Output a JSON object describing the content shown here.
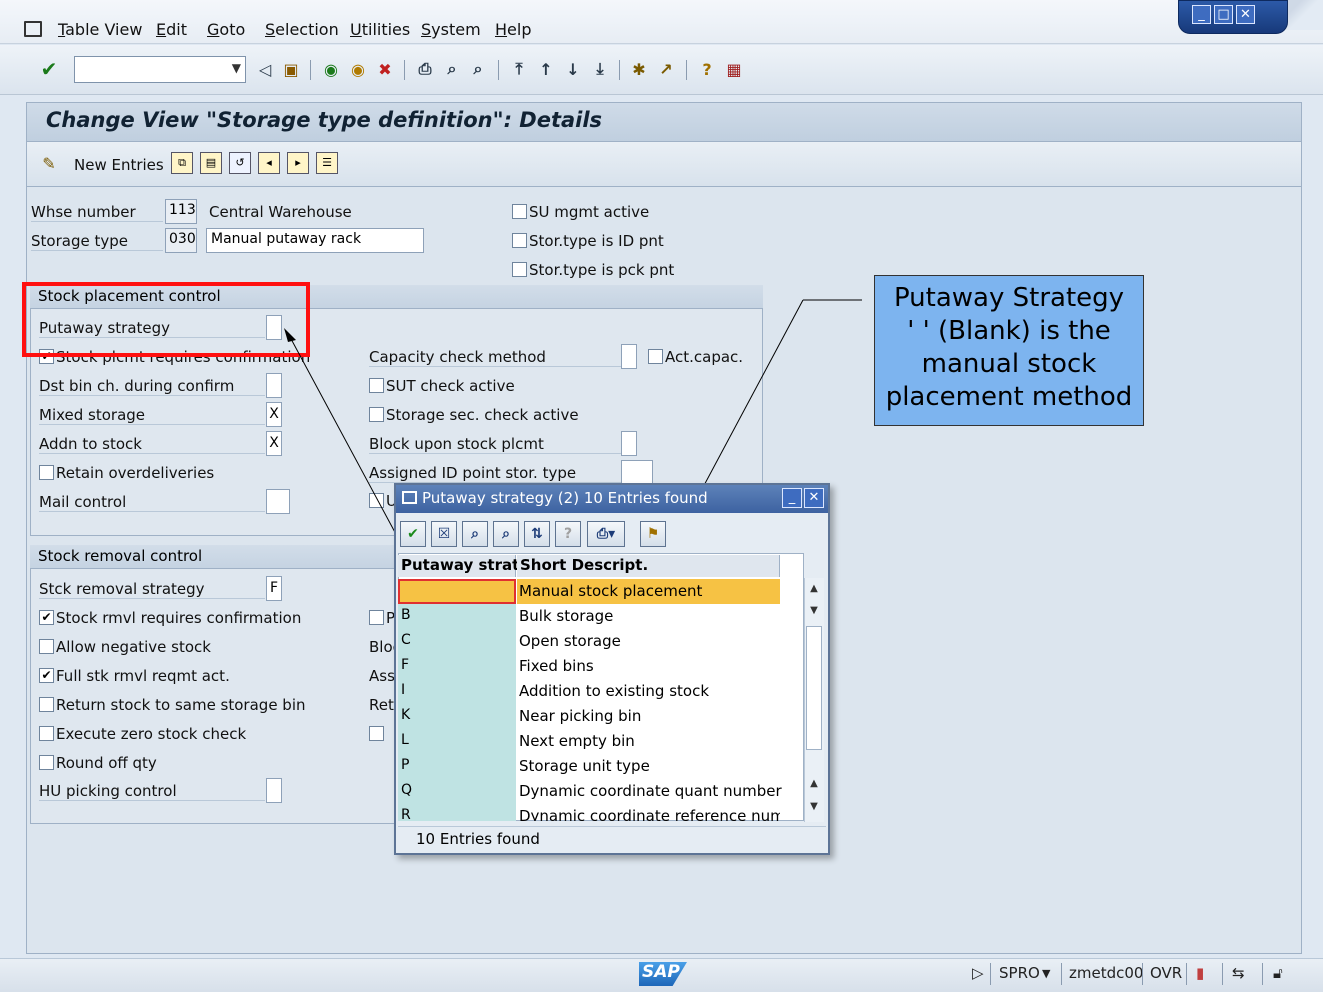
{
  "menu": {
    "items": [
      "Table View",
      "Edit",
      "Goto",
      "Selection",
      "Utilities",
      "System",
      "Help"
    ]
  },
  "page": {
    "title": "Change View \"Storage type definition\": Details"
  },
  "app_toolbar": {
    "new_entries": "New Entries"
  },
  "header": {
    "whse_label": "Whse number",
    "whse_value": "113",
    "whse_desc": "Central Warehouse",
    "stortype_label": "Storage type",
    "stortype_value": "030",
    "stortype_desc": "Manual putaway rack",
    "su_mgmt": "SU mgmt active",
    "id_pnt": "Stor.type is ID pnt",
    "pck_pnt": "Stor.type is pck pnt"
  },
  "placement": {
    "title": "Stock placement control",
    "putaway_strategy": "Putaway strategy",
    "requires_confirmation": "Stock plcmt requires confirmation",
    "dst_bin": "Dst bin ch. during confirm",
    "mixed_storage": "Mixed storage",
    "mixed_value": "X",
    "addn_to_stock": "Addn to stock",
    "addn_value": "X",
    "retain_overdeliveries": "Retain overdeliveries",
    "mail_control": "Mail control",
    "capacity_check": "Capacity check method",
    "act_capac": "Act.capac.",
    "sut_check": "SUT check active",
    "storage_sec": "Storage sec. check active",
    "block_upon": "Block upon stock plcmt",
    "assigned_id": "Assigned ID point stor. type",
    "partial_u": "U"
  },
  "removal": {
    "title": "Stock removal control",
    "strategy": "Stck removal strategy",
    "strategy_value": "F",
    "requires_confirmation": "Stock rmvl requires confirmation",
    "allow_negative": "Allow negative stock",
    "full_stk": "Full stk rmvl reqmt act.",
    "return_stock": "Return stock to same storage bin",
    "zero_stock": "Execute zero stock check",
    "round_off": "Round off qty",
    "hu_picking": "HU picking control",
    "partial_p": "P",
    "partial_bloc": "Bloc",
    "partial_assi": "Assi",
    "partial_retu": "Retu"
  },
  "popup": {
    "title": "Putaway strategy (2)   10 Entries found",
    "col_key": "Putaway strat",
    "col_desc": "Short Descript.",
    "rows": [
      {
        "key": "",
        "desc": "Manual stock placement"
      },
      {
        "key": "B",
        "desc": "Bulk storage"
      },
      {
        "key": "C",
        "desc": "Open storage"
      },
      {
        "key": "F",
        "desc": "Fixed bins"
      },
      {
        "key": "I",
        "desc": "Addition to existing stock"
      },
      {
        "key": "K",
        "desc": "Near picking bin"
      },
      {
        "key": "L",
        "desc": "Next empty bin"
      },
      {
        "key": "P",
        "desc": "Storage unit type"
      },
      {
        "key": "Q",
        "desc": "Dynamic coordinate quant number"
      },
      {
        "key": "R",
        "desc": "Dynamic coordinate reference number"
      }
    ],
    "status": "10 Entries found"
  },
  "callout": {
    "line1": "Putaway Strategy",
    "line2": "' ' (Blank) is the",
    "line3": "manual stock",
    "line4": "placement method"
  },
  "status_bar": {
    "logo": "SAP",
    "transaction": "SPRO",
    "server": "zmetdc00",
    "mode": "OVR"
  },
  "colors": {
    "accent": "#3d62a1",
    "selected_row": "#f6c244",
    "key_column": "#bfe3e3",
    "callout_bg": "#7db4ef",
    "highlight_box": "#ff1010"
  }
}
